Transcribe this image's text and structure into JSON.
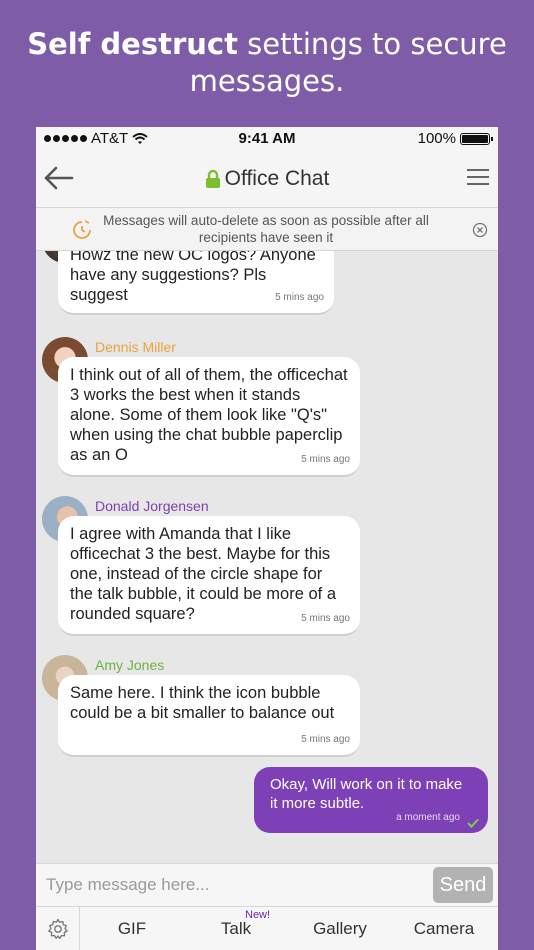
{
  "headline": {
    "bold": "Self destruct",
    "rest": " settings to secure messages."
  },
  "status": {
    "carrier": "AT&T",
    "time": "9:41 AM",
    "battery": "100%"
  },
  "nav": {
    "title": "Office Chat"
  },
  "notice": {
    "text": "Messages will auto-delete as soon as possible after all recipients have seen it"
  },
  "messages": [
    {
      "text": "Howz the new OC logos? Anyone have any suggestions? Pls suggest",
      "time": "5 mins ago"
    },
    {
      "sender": "Dennis Miller",
      "sender_color": "#e8a33c",
      "text": "I think out of all of them, the officechat 3 works the best when it stands alone. Some of them look like \"Q's\" when using the chat bubble paperclip as an O",
      "time": "5 mins ago"
    },
    {
      "sender": "Donald Jorgensen",
      "sender_color": "#7e3fb3",
      "text": "I agree with Amanda that I like officechat 3 the best. Maybe for this one, instead of the circle shape for the talk bubble, it could be more of a rounded square?",
      "time": "5 mins ago"
    },
    {
      "sender": "Amy Jones",
      "sender_color": "#6cb33f",
      "text": "Same here. I think the icon bubble could be a bit smaller to balance out",
      "time": "5 mins ago"
    }
  ],
  "my_message": {
    "text": "Okay, Will work on it to make it more subtle.",
    "time": "a moment ago"
  },
  "input": {
    "placeholder": "Type message here...",
    "send": "Send"
  },
  "toolbar": {
    "gif": "GIF",
    "talk": "Talk",
    "new_badge": "New!",
    "gallery": "Gallery",
    "camera": "Camera"
  },
  "colors": {
    "brand": "#7e5ca8",
    "my_bubble": "#7e40b7"
  }
}
